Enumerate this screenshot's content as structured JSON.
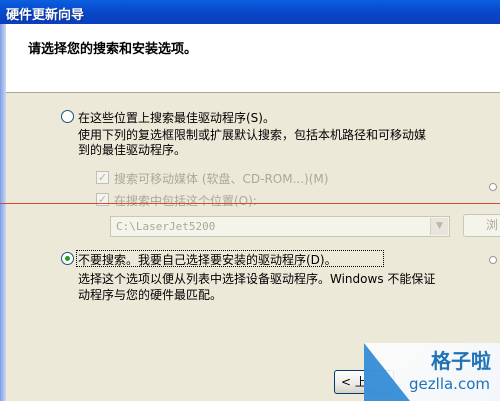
{
  "window": {
    "title": "硬件更新向导"
  },
  "header": {
    "heading": "请选择您的搜索和安装选项。"
  },
  "search_option": {
    "label": "在这些位置上搜索最佳驱动程序(S)。",
    "desc_line1": "使用下列的复选框限制或扩展默认搜索，包括本机路径和可移动媒",
    "desc_line2": "到的最佳驱动程序。",
    "removable_media_label": "搜索可移动媒体 (软盘、CD-ROM...)(M)",
    "include_location_label": "在搜索中包括这个位置(O):",
    "location_value": "C:\\LaserJet5200",
    "browse_label": "浏"
  },
  "manual_option": {
    "label": "不要搜索。我要自己选择要安装的驱动程序(D)。",
    "desc_line1": "选择这个选项以便从列表中选择设备驱动程序。Windows 不能保证",
    "desc_line2": "动程序与您的硬件最匹配。"
  },
  "footer": {
    "back_label": "< 上"
  },
  "watermark": {
    "cn": "格子啦",
    "en": "gezlla.com"
  },
  "colors": {
    "accent": "#0a5fe0",
    "link_blue": "#1f73b7",
    "radio_green": "#21a121"
  }
}
